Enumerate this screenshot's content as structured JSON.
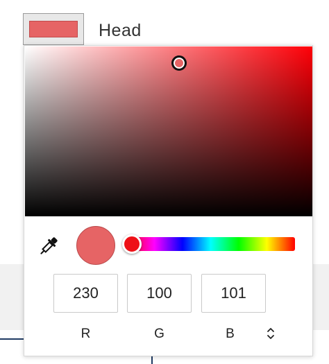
{
  "swatch": {
    "label": "Head",
    "color": "#e66465"
  },
  "picker": {
    "selected_color": "#e66465",
    "hue_color": "#ff0008",
    "rgb": {
      "r": "230",
      "g": "100",
      "b": "101"
    },
    "labels": {
      "r": "R",
      "g": "G",
      "b": "B"
    },
    "icons": {
      "eyedropper": "eyedropper-icon",
      "mode_toggle": "chevron-up-down-icon"
    }
  },
  "theme": {
    "accent_line": "#1f3a63",
    "panel_background": "#f1f1f1"
  }
}
